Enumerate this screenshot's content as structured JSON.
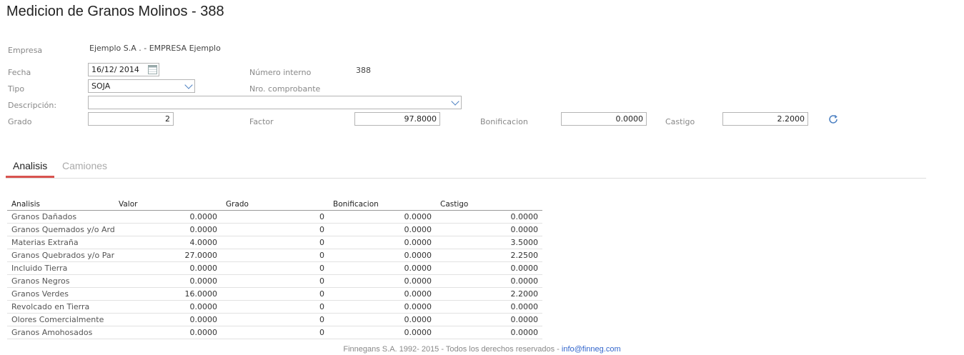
{
  "title": "Medicion de Granos Molinos - 388",
  "form": {
    "empresa_label": "Empresa",
    "empresa_value": "Ejemplo S.A . - EMPRESA Ejemplo",
    "fecha_label": "Fecha",
    "fecha_value": "16/12/ 2014",
    "numero_interno_label": "Número interno",
    "numero_interno_value": "388",
    "tipo_label": "Tipo",
    "tipo_value": "SOJA",
    "nro_comprobante_label": "Nro. comprobante",
    "descripcion_label": "Descripción:",
    "descripcion_value": "",
    "grado_label": "Grado",
    "grado_value": "2",
    "factor_label": "Factor",
    "factor_value": "97.8000",
    "bonificacion_label": "Bonificacion",
    "bonificacion_value": "0.0000",
    "castigo_label": "Castigo",
    "castigo_value": "2.2000"
  },
  "tabs": [
    {
      "label": "Analisis",
      "active": true
    },
    {
      "label": "Camiones",
      "active": false
    }
  ],
  "table": {
    "columns": [
      "Analisis",
      "Valor",
      "Grado",
      "Bonificacion",
      "Castigo"
    ],
    "rows": [
      [
        "Granos Dañados",
        "0.0000",
        "0",
        "0.0000",
        "0.0000"
      ],
      [
        "Granos Quemados y/o Ardidos",
        "0.0000",
        "0",
        "0.0000",
        "0.0000"
      ],
      [
        "Materias Extraña",
        "4.0000",
        "0",
        "0.0000",
        "3.5000"
      ],
      [
        "Granos Quebrados y/o Partidos",
        "27.0000",
        "0",
        "0.0000",
        "2.2500"
      ],
      [
        "Incluido Tierra",
        "0.0000",
        "0",
        "0.0000",
        "0.0000"
      ],
      [
        "Granos Negros",
        "0.0000",
        "0",
        "0.0000",
        "0.0000"
      ],
      [
        "Granos Verdes",
        "16.0000",
        "0",
        "0.0000",
        "2.2000"
      ],
      [
        "Revolcado en Tierra",
        "0.0000",
        "0",
        "0.0000",
        "0.0000"
      ],
      [
        "Olores Comercialmente",
        "0.0000",
        "0",
        "0.0000",
        "0.0000"
      ],
      [
        "Granos Amohosados",
        "0.0000",
        "0",
        "0.0000",
        "0.0000"
      ]
    ]
  },
  "footer": {
    "text": "Finnegans S.A. 1992- 2015 - Todos los derechos reservados - ",
    "link": "info@finneg.com"
  },
  "icons": {
    "calendar": "calendar-icon",
    "dropdown": "chevron-down-icon",
    "refresh": "refresh-icon"
  },
  "colors": {
    "tab_active_underline": "#d9534f",
    "accent_blue": "#4a7fc1",
    "link": "#3366cc"
  }
}
